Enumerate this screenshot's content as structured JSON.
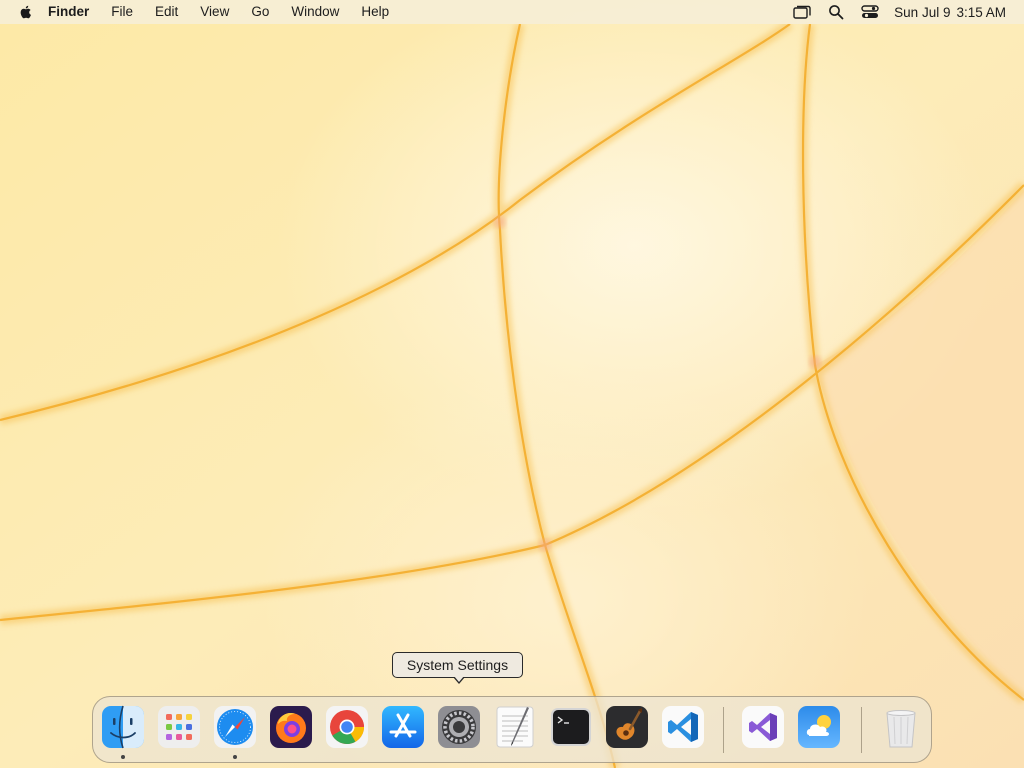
{
  "menubar": {
    "app_name": "Finder",
    "menus": [
      "File",
      "Edit",
      "View",
      "Go",
      "Window",
      "Help"
    ],
    "status_icons": [
      "screen-mirroring-icon",
      "spotlight-search-icon",
      "control-center-icon"
    ],
    "date": "Sun Jul 9",
    "time": "3:15 AM"
  },
  "tooltip": {
    "text": "System Settings"
  },
  "dock": {
    "apps": [
      {
        "name": "Finder",
        "icon": "finder-icon",
        "running": true
      },
      {
        "name": "Launchpad",
        "icon": "launchpad-icon",
        "running": false
      },
      {
        "name": "Safari",
        "icon": "safari-icon",
        "running": true
      },
      {
        "name": "Firefox",
        "icon": "firefox-icon",
        "running": false
      },
      {
        "name": "Google Chrome",
        "icon": "chrome-icon",
        "running": false
      },
      {
        "name": "App Store",
        "icon": "app-store-icon",
        "running": false
      },
      {
        "name": "System Settings",
        "icon": "system-settings-icon",
        "running": false
      },
      {
        "name": "TextEdit",
        "icon": "textedit-icon",
        "running": false
      },
      {
        "name": "Terminal",
        "icon": "terminal-icon",
        "running": false
      },
      {
        "name": "GarageBand",
        "icon": "garageband-icon",
        "running": false
      },
      {
        "name": "Visual Studio Code",
        "icon": "vscode-icon",
        "running": false
      },
      {
        "name": "Visual Studio",
        "icon": "visual-studio-icon",
        "running": false
      },
      {
        "name": "Weather",
        "icon": "weather-icon",
        "running": false
      },
      {
        "name": "Trash",
        "icon": "trash-icon",
        "running": false
      }
    ]
  },
  "colors": {
    "wallpaper_base": "#fdebb0",
    "wallpaper_stripe": "#f6b640",
    "menubar_bg": "#f6eed6",
    "dock_bg": "#ece4d2"
  }
}
